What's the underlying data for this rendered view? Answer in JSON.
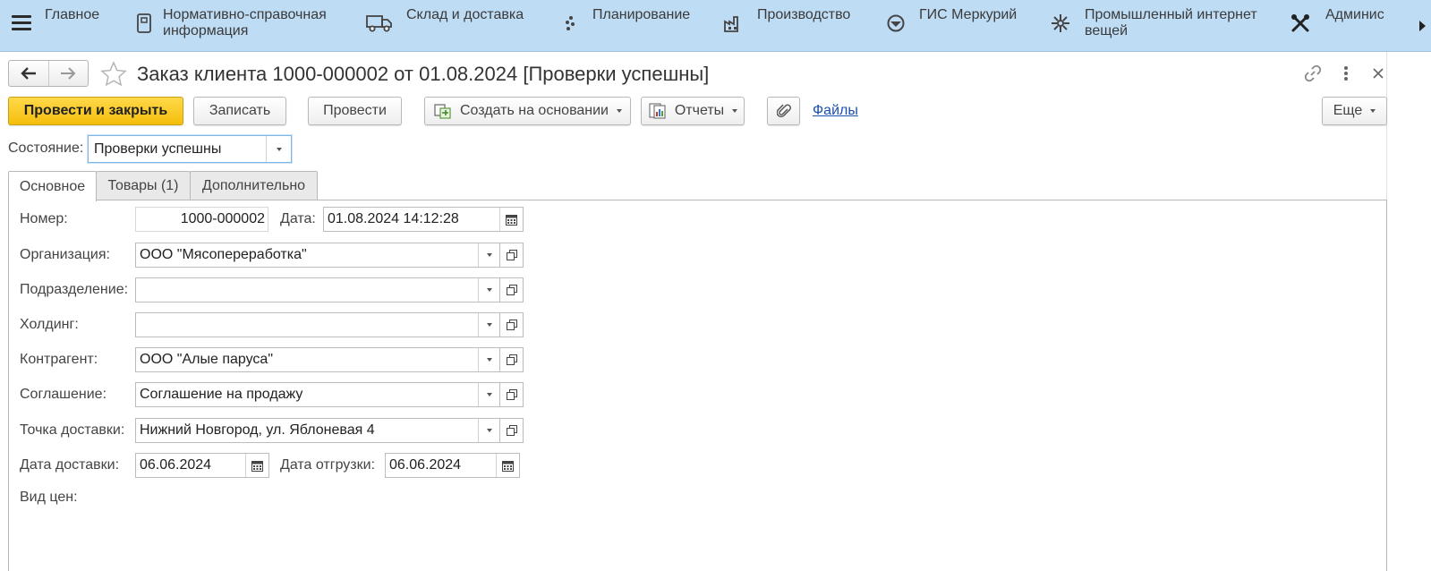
{
  "sections": [
    {
      "label": "Главное",
      "icon": "home-icon"
    },
    {
      "label": "Нормативно-справочная\nинформация",
      "icon": "book-icon"
    },
    {
      "label": "Склад и доставка",
      "icon": "truck-icon"
    },
    {
      "label": "Планирование",
      "icon": "planning-icon"
    },
    {
      "label": "Производство",
      "icon": "factory-icon"
    },
    {
      "label": "ГИС Меркурий",
      "icon": "mercury-icon"
    },
    {
      "label": "Промышленный интернет\nвещей",
      "icon": "iot-icon"
    },
    {
      "label": "Админис",
      "icon": "tools-icon"
    }
  ],
  "document": {
    "title": "Заказ клиента 1000-000002 от 01.08.2024 [Проверки успешны]"
  },
  "toolbar": {
    "post_and_close": "Провести и закрыть",
    "save": "Записать",
    "post": "Провести",
    "create_based_on": "Создать на основании",
    "reports": "Отчеты",
    "files": "Файлы",
    "more": "Еще"
  },
  "state": {
    "label": "Состояние:",
    "value": "Проверки успешны"
  },
  "tabs": [
    {
      "label": "Основное",
      "active": true
    },
    {
      "label": "Товары (1)",
      "active": false
    },
    {
      "label": "Дополнительно",
      "active": false
    }
  ],
  "form": {
    "number_label": "Номер:",
    "number_value": "1000-000002",
    "date_label": "Дата:",
    "date_value": "01.08.2024 14:12:28",
    "organization_label": "Организация:",
    "organization_value": "ООО \"Мясопереработка\"",
    "department_label": "Подразделение:",
    "department_value": "",
    "holding_label": "Холдинг:",
    "holding_value": "",
    "counterparty_label": "Контрагент:",
    "counterparty_value": "ООО \"Алые паруса\"",
    "agreement_label": "Соглашение:",
    "agreement_value": "Соглашение на продажу",
    "delivery_point_label": "Точка доставки:",
    "delivery_point_value": "Нижний Новгород, ул. Яблоневая 4",
    "delivery_date_label": "Дата доставки:",
    "delivery_date_value": "06.06.2024",
    "shipment_date_label": "Дата отгрузки:",
    "shipment_date_value": "06.06.2024",
    "price_type_label": "Вид цен:"
  },
  "colors": {
    "section_bar": "#bfdcf5",
    "primary_button": "#f5be0b",
    "link": "#1c4fae"
  }
}
